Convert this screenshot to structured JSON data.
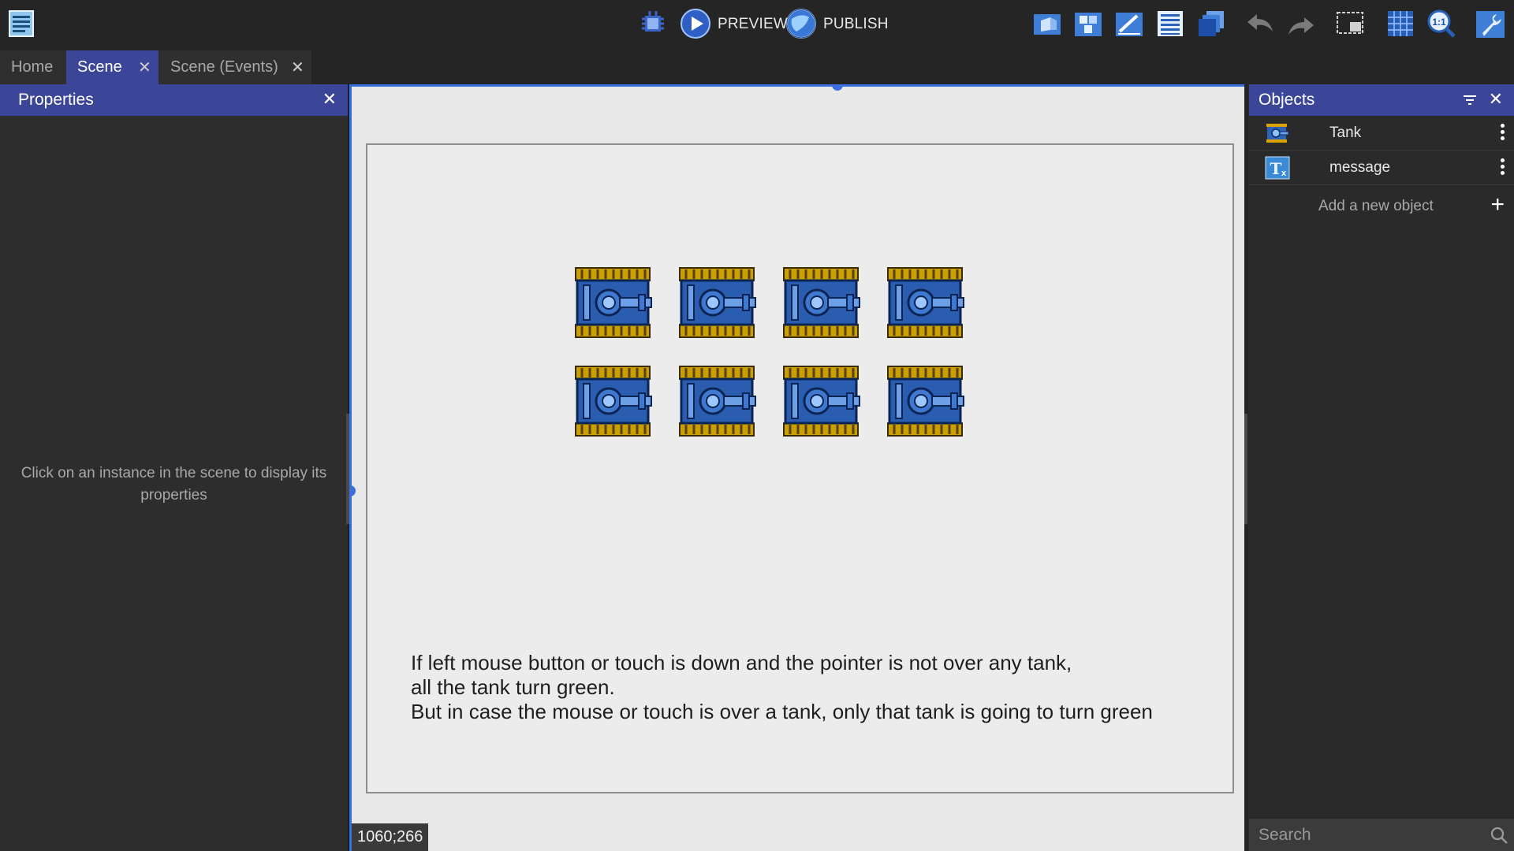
{
  "toolbar": {
    "preview_label": "PREVIEW",
    "publish_label": "PUBLISH"
  },
  "tabs": [
    {
      "label": "Home",
      "active": false,
      "closable": false
    },
    {
      "label": "Scene",
      "active": true,
      "closable": true
    },
    {
      "label": "Scene (Events)",
      "active": false,
      "closable": true
    }
  ],
  "properties": {
    "title": "Properties",
    "empty_message": "Click on an instance in the scene to display its properties"
  },
  "scene": {
    "message_lines": [
      "If left mouse button or touch is down and the pointer is not over any tank,",
      "all the tank turn green.",
      "But in case the mouse or touch is over a tank, only that tank is going to turn green"
    ],
    "cursor_coords": "1060;266",
    "tank_count": 8
  },
  "objects": {
    "title": "Objects",
    "items": [
      {
        "name": "Tank",
        "icon": "tank-thumbnail-icon"
      },
      {
        "name": "message",
        "icon": "text-object-icon"
      }
    ],
    "add_label": "Add a new object",
    "search_placeholder": "Search"
  },
  "colors": {
    "accent": "#3c4698",
    "selection": "#3b6fe0",
    "background": "#252525",
    "canvas": "#e8e8e8"
  }
}
